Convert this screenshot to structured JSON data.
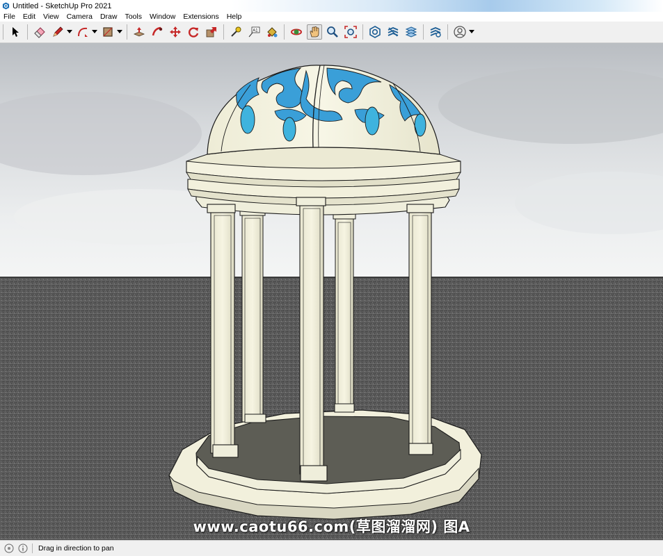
{
  "window": {
    "title": "Untitled - SketchUp Pro 2021"
  },
  "menu": {
    "items": [
      "File",
      "Edit",
      "View",
      "Camera",
      "Draw",
      "Tools",
      "Window",
      "Extensions",
      "Help"
    ]
  },
  "toolbar": {
    "tools": [
      {
        "name": "select-icon",
        "label": "Select"
      },
      {
        "name": "eraser-icon",
        "label": "Eraser"
      },
      {
        "name": "pencil-icon",
        "label": "Line"
      },
      {
        "name": "arc-icon",
        "label": "Arc"
      },
      {
        "name": "rectangle-icon",
        "label": "Shapes"
      },
      {
        "name": "push-pull-icon",
        "label": "Push/Pull"
      },
      {
        "name": "follow-me-icon",
        "label": "Follow Me"
      },
      {
        "name": "move-icon",
        "label": "Move"
      },
      {
        "name": "rotate-icon",
        "label": "Rotate"
      },
      {
        "name": "scale-icon",
        "label": "Scale"
      },
      {
        "name": "tape-measure-icon",
        "label": "Tape Measure"
      },
      {
        "name": "text-icon",
        "label": "Text"
      },
      {
        "name": "paint-bucket-icon",
        "label": "Paint Bucket"
      },
      {
        "name": "orbit-icon",
        "label": "Orbit"
      },
      {
        "name": "pan-icon",
        "label": "Pan"
      },
      {
        "name": "zoom-icon",
        "label": "Zoom"
      },
      {
        "name": "zoom-extents-icon",
        "label": "Zoom Extents"
      },
      {
        "name": "warehouse-icon",
        "label": "3D Warehouse"
      },
      {
        "name": "extension-warehouse-icon",
        "label": "Extension Warehouse"
      },
      {
        "name": "layout-icon",
        "label": "Send to LayOut"
      },
      {
        "name": "extension-manager-icon",
        "label": "Extension Manager"
      },
      {
        "name": "account-icon",
        "label": "Account"
      }
    ],
    "active_tool": "pan-icon"
  },
  "status": {
    "message": "Drag in direction to pan"
  },
  "watermark": {
    "text": "www.caotu66.com(草图溜溜网) 图A"
  },
  "colors": {
    "sky_top": "#c9ccd0",
    "ground": "#5a5a5a",
    "model_face": "#f2f0dc",
    "dome_glass": "#3a9fd8",
    "inner_glow": "#8a7fe0",
    "edge": "#1a1a1a"
  }
}
